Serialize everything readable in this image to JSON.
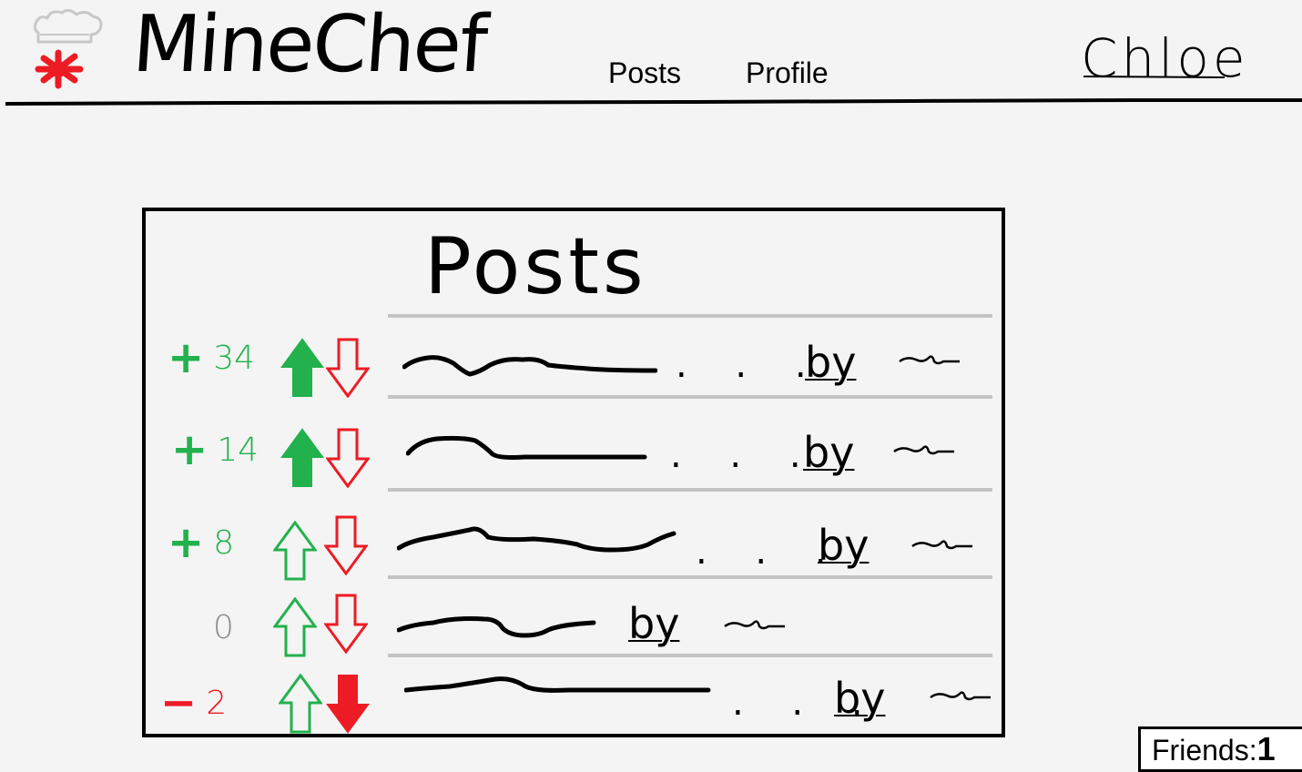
{
  "app": {
    "brand": "MineChef",
    "brand_logo_icon": "chef-hat-icon",
    "brand_colors": {
      "hat": "#d3d3d3",
      "splat": "#ed1c24"
    }
  },
  "nav": {
    "items": [
      {
        "label": "Posts"
      },
      {
        "label": "Profile"
      }
    ]
  },
  "user": {
    "name": "Chloe"
  },
  "posts_panel": {
    "title": "Posts",
    "by_label": "by",
    "colors": {
      "positive": "#22b14c",
      "neutral": "#8a8a8a",
      "negative": "#ed1c24",
      "divider": "#c3c3c3"
    },
    "posts": [
      {
        "sign": "+",
        "score": "34",
        "score_type": "positive",
        "upvoted": true,
        "downvoted": false,
        "ellipsis": ". . ."
      },
      {
        "sign": "+",
        "score": "14",
        "score_type": "positive",
        "upvoted": true,
        "downvoted": false,
        "ellipsis": ". . ."
      },
      {
        "sign": "+",
        "score": "8",
        "score_type": "positive",
        "upvoted": false,
        "downvoted": false,
        "ellipsis": ". . ."
      },
      {
        "sign": "",
        "score": "0",
        "score_type": "neutral",
        "upvoted": false,
        "downvoted": false,
        "ellipsis": ""
      },
      {
        "sign": "−",
        "score": "2",
        "score_type": "negative",
        "upvoted": false,
        "downvoted": true,
        "ellipsis": ". . ."
      }
    ]
  },
  "friends": {
    "label": "Friends:",
    "count": "1"
  }
}
